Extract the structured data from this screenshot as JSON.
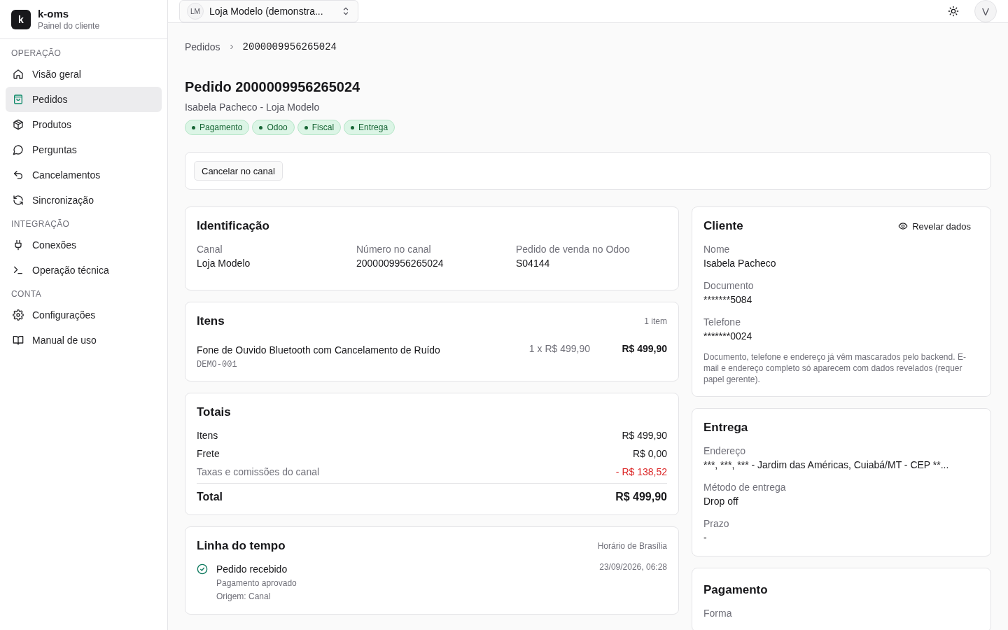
{
  "brand": {
    "logo": "k",
    "name": "k-oms",
    "subtitle": "Painel do cliente"
  },
  "sidebar": {
    "sections": [
      {
        "title": "OPERAÇÃO",
        "items": [
          {
            "label": "Visão geral",
            "selected": false
          },
          {
            "label": "Pedidos",
            "selected": true
          },
          {
            "label": "Produtos",
            "selected": false
          },
          {
            "label": "Perguntas",
            "selected": false
          },
          {
            "label": "Cancelamentos",
            "selected": false
          },
          {
            "label": "Sincronização",
            "selected": false
          }
        ]
      },
      {
        "title": "INTEGRAÇÃO",
        "items": [
          {
            "label": "Conexões",
            "selected": false
          },
          {
            "label": "Operação técnica",
            "selected": false
          }
        ]
      },
      {
        "title": "CONTA",
        "items": [
          {
            "label": "Configurações",
            "selected": false
          },
          {
            "label": "Manual de uso",
            "selected": false
          }
        ]
      }
    ]
  },
  "topbar": {
    "store": {
      "initials": "LM",
      "name": "Loja Modelo (demonstra..."
    },
    "avatar": "V"
  },
  "breadcrumb": [
    "Pedidos",
    "2000009956265024"
  ],
  "order": {
    "title": "Pedido 2000009956265024",
    "subtitle": "Isabela Pacheco - Loja Modelo",
    "badges": [
      "Pagamento",
      "Odoo",
      "Fiscal",
      "Entrega"
    ]
  },
  "actions": [
    "Cancelar no canal"
  ],
  "identification": {
    "title": "Identificação",
    "fields": [
      {
        "label": "Canal",
        "value": "Loja Modelo"
      },
      {
        "label": "Número no canal",
        "value": "2000009956265024"
      },
      {
        "label": "Pedido de venda no Odoo",
        "value": "S04144"
      }
    ]
  },
  "items": {
    "title": "Itens",
    "count": "1 item",
    "rows": [
      {
        "name": "Fone de Ouvido Bluetooth com Cancelamento de Ruído",
        "sku": "DEMO-001",
        "quantity_price": "1 x R$ 499,90",
        "total": "R$ 499,90"
      }
    ]
  },
  "totals": {
    "title": "Totais",
    "rows": [
      {
        "label": "Itens",
        "value": "R$ 499,90",
        "kind": "normal"
      },
      {
        "label": "Frete",
        "value": "R$ 0,00",
        "kind": "normal"
      },
      {
        "label": "Taxas e comissões do canal",
        "value": "- R$ 138,52",
        "kind": "deduction"
      }
    ],
    "total": {
      "label": "Total",
      "value": "R$ 499,90"
    }
  },
  "timeline": {
    "title": "Linha do tempo",
    "timezone": "Horário de Brasília",
    "events": [
      {
        "title": "Pedido recebido",
        "details": [
          "Pagamento aprovado",
          "Origem: Canal"
        ],
        "time": "23/09/2026, 06:28"
      }
    ]
  },
  "customer": {
    "title": "Cliente",
    "reveal": "Revelar dados",
    "fields": [
      {
        "label": "Nome",
        "value": "Isabela Pacheco"
      },
      {
        "label": "Documento",
        "value": "*******5084"
      },
      {
        "label": "Telefone",
        "value": "*******0024"
      }
    ],
    "note": "Documento, telefone e endereço já vêm mascarados pelo backend. E-mail e endereço completo só aparecem com dados revelados (requer papel gerente)."
  },
  "delivery": {
    "title": "Entrega",
    "fields": [
      {
        "label": "Endereço",
        "value": "***, ***, *** - Jardim das Américas, Cuiabá/MT - CEP **..."
      },
      {
        "label": "Método de entrega",
        "value": "Drop off"
      },
      {
        "label": "Prazo",
        "value": "-"
      }
    ]
  },
  "payment": {
    "title": "Pagamento",
    "fields": [
      {
        "label": "Forma"
      }
    ]
  }
}
